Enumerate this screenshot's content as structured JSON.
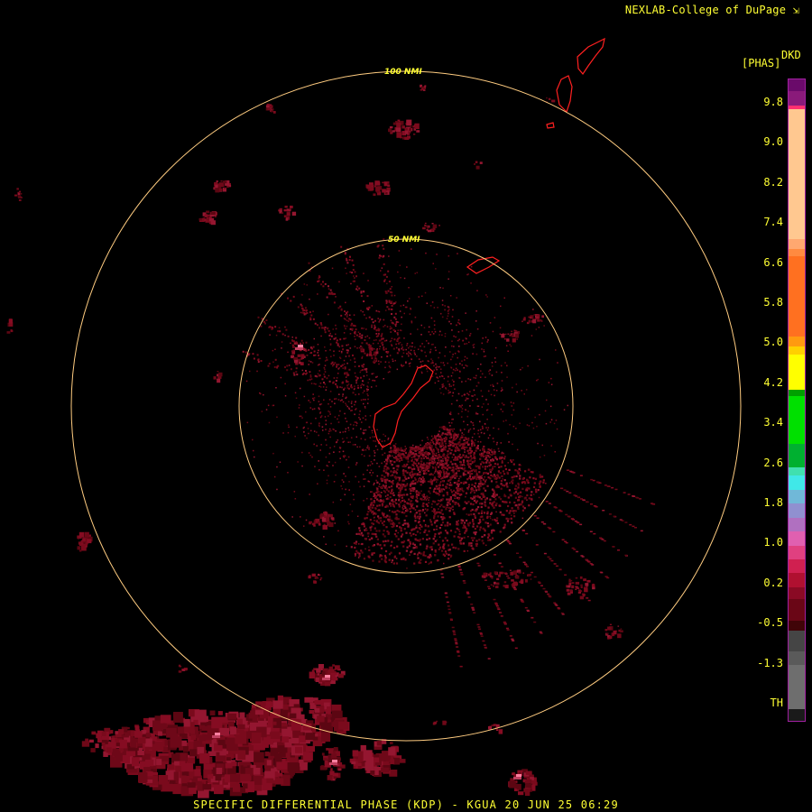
{
  "header": {
    "credit": "NEXLAB-College of DuPage",
    "credit_icon": "arrow-icon"
  },
  "legend": {
    "unit_top": "DKD",
    "unit_sub": "[PHAS]",
    "ticks": [
      "9.8",
      "9.0",
      "8.2",
      "7.4",
      "6.6",
      "5.8",
      "5.0",
      "4.2",
      "3.4",
      "2.6",
      "1.8",
      "1.0",
      "0.2",
      "-0.5",
      "-1.3",
      "TH"
    ]
  },
  "rings": {
    "inner_label": "50 NMI",
    "outer_label": "100 NMI"
  },
  "footer": {
    "title": "SPECIFIC DIFFERENTIAL PHASE (KDP) - KGUA 20 JUN 25 06:29"
  },
  "colors": {
    "background": "#000000",
    "ring": "#ffcc80",
    "text": "#ffff33",
    "coast": "#ff2020",
    "echo": "#7a0a1c",
    "echo_light": "#9a1a33",
    "echo_hot": "#ff7fa0"
  }
}
